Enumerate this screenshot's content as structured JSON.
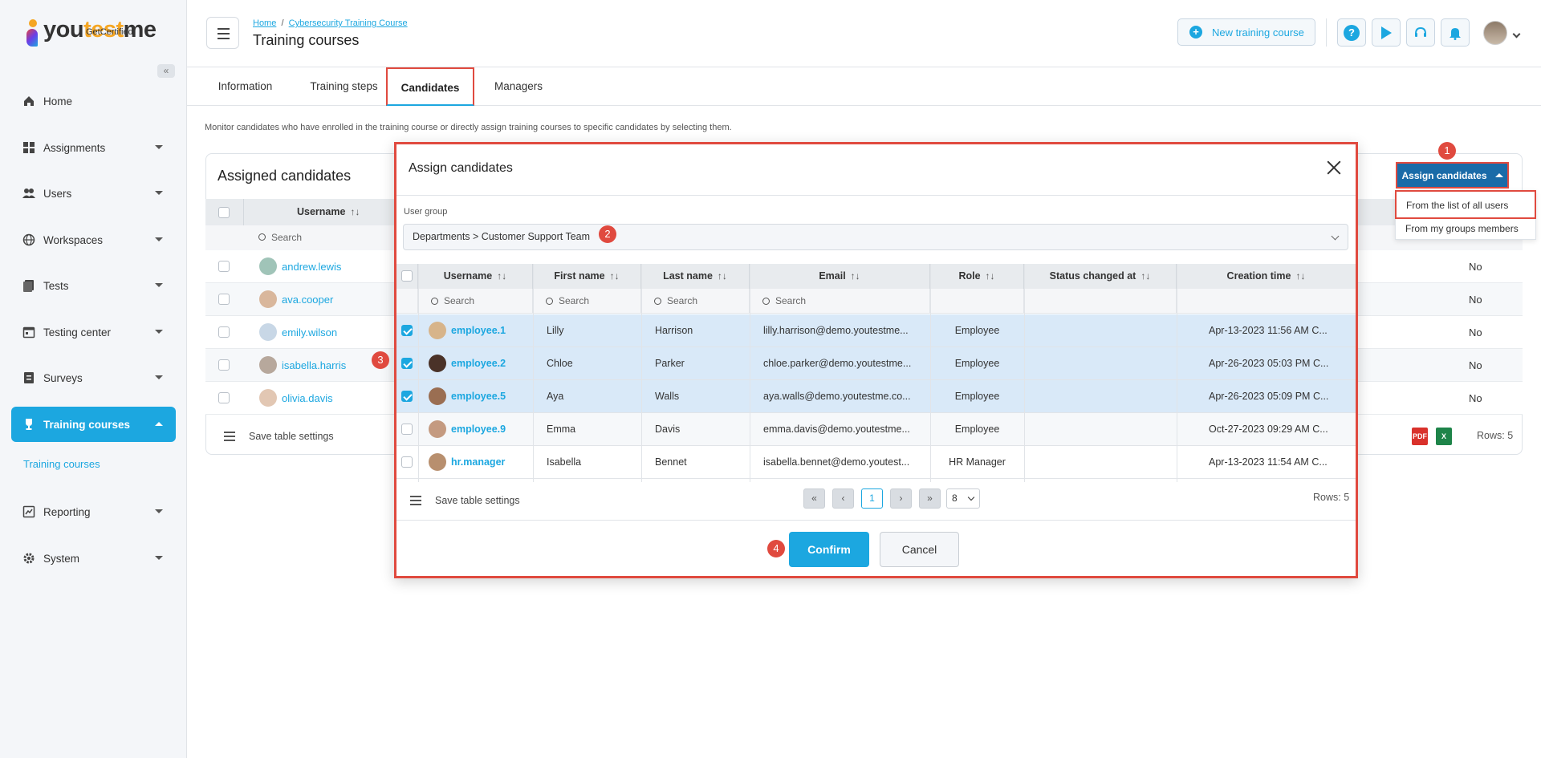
{
  "brand": {
    "name_a": "you",
    "name_b": "test",
    "name_c": "me",
    "tagline": "GetCertified",
    "collapse": "«"
  },
  "sidebar": {
    "items": [
      {
        "label": "Home",
        "icon": "home-icon"
      },
      {
        "label": "Assignments",
        "icon": "assignments-icon"
      },
      {
        "label": "Users",
        "icon": "users-icon"
      },
      {
        "label": "Workspaces",
        "icon": "globe-icon"
      },
      {
        "label": "Tests",
        "icon": "tests-icon"
      },
      {
        "label": "Testing center",
        "icon": "calendar-icon"
      },
      {
        "label": "Surveys",
        "icon": "surveys-icon"
      },
      {
        "label": "Training courses",
        "icon": "trophy-icon",
        "active": true
      },
      {
        "label": "Reporting",
        "icon": "reporting-icon"
      },
      {
        "label": "System",
        "icon": "gear-icon"
      }
    ],
    "subitem": "Training courses"
  },
  "header": {
    "breadcrumb_home": "Home",
    "breadcrumb_sep": "/",
    "breadcrumb_course": "Cybersecurity Training Course",
    "title": "Training courses",
    "new_course": "New training course",
    "new_course_plus": "+",
    "help": "?"
  },
  "tabs": [
    "Information",
    "Training steps",
    "Candidates",
    "Managers"
  ],
  "description": "Monitor candidates who have enrolled in the training course or directly assign training courses to specific candidates by selecting them.",
  "background_table": {
    "title": "Assigned candidates",
    "col_username": "Username",
    "sort": "↑↓",
    "search": "Search",
    "rows": [
      {
        "username": "andrew.lewis",
        "value": "No"
      },
      {
        "username": "ava.cooper",
        "value": "No"
      },
      {
        "username": "emily.wilson",
        "value": "No"
      },
      {
        "username": "isabella.harris",
        "value": "No"
      },
      {
        "username": "olivia.davis",
        "value": "No"
      }
    ],
    "save_settings": "Save table settings",
    "rows_count": "Rows: 5",
    "export_pdf": "PDF",
    "export_xls": "X"
  },
  "assign_menu": {
    "button": "Assign candidates",
    "option_all": "From the list of all users",
    "option_groups": "From my groups members"
  },
  "steps": [
    "1",
    "2",
    "3",
    "4"
  ],
  "modal": {
    "title": "Assign candidates",
    "user_group_label": "User group",
    "user_group_value": "Departments > Customer Support Team",
    "columns": [
      "Username",
      "First name",
      "Last name",
      "Email",
      "Role",
      "Status changed at",
      "Creation time"
    ],
    "sort": "↑↓",
    "search": "Search",
    "rows": [
      {
        "username": "employee.1",
        "first": "Lilly",
        "last": "Harrison",
        "email": "lilly.harrison@demo.youtestme...",
        "role": "Employee",
        "status": "",
        "created": "Apr-13-2023 11:56 AM C...",
        "checked": true,
        "avatar": "#d7b48a"
      },
      {
        "username": "employee.2",
        "first": "Chloe",
        "last": "Parker",
        "email": "chloe.parker@demo.youtestmе...",
        "role": "Employee",
        "status": "",
        "created": "Apr-26-2023 05:03 PM C...",
        "checked": true,
        "avatar": "#4a3228"
      },
      {
        "username": "employee.5",
        "first": "Aya",
        "last": "Walls",
        "email": "aya.walls@demo.youtestme.co...",
        "role": "Employee",
        "status": "",
        "created": "Apr-26-2023 05:09 PM C...",
        "checked": true,
        "avatar": "#9a6e52"
      },
      {
        "username": "employee.9",
        "first": "Emma",
        "last": "Davis",
        "email": "emma.davis@demo.youtestme...",
        "role": "Employee",
        "status": "",
        "created": "Oct-27-2023 09:29 AM C...",
        "checked": false,
        "avatar": "#c49a80"
      },
      {
        "username": "hr.manager",
        "first": "Isabella",
        "last": "Bennet",
        "email": "isabella.bennet@demo.youtest...",
        "role": "HR Manager",
        "status": "",
        "created": "Apr-13-2023 11:54 AM C...",
        "checked": false,
        "avatar": "#b88f6e"
      }
    ],
    "save_settings": "Save table settings",
    "pager": {
      "first": "«",
      "prev": "‹",
      "current": "1",
      "next": "›",
      "last": "»",
      "page_size": "8"
    },
    "rows_count": "Rows: 5",
    "confirm": "Confirm",
    "cancel": "Cancel"
  },
  "colors": {
    "accent": "#1ca7e0",
    "highlight": "#e04a3f",
    "dark_blue": "#1a6ba8",
    "selected_row": "#d9e9f8"
  }
}
